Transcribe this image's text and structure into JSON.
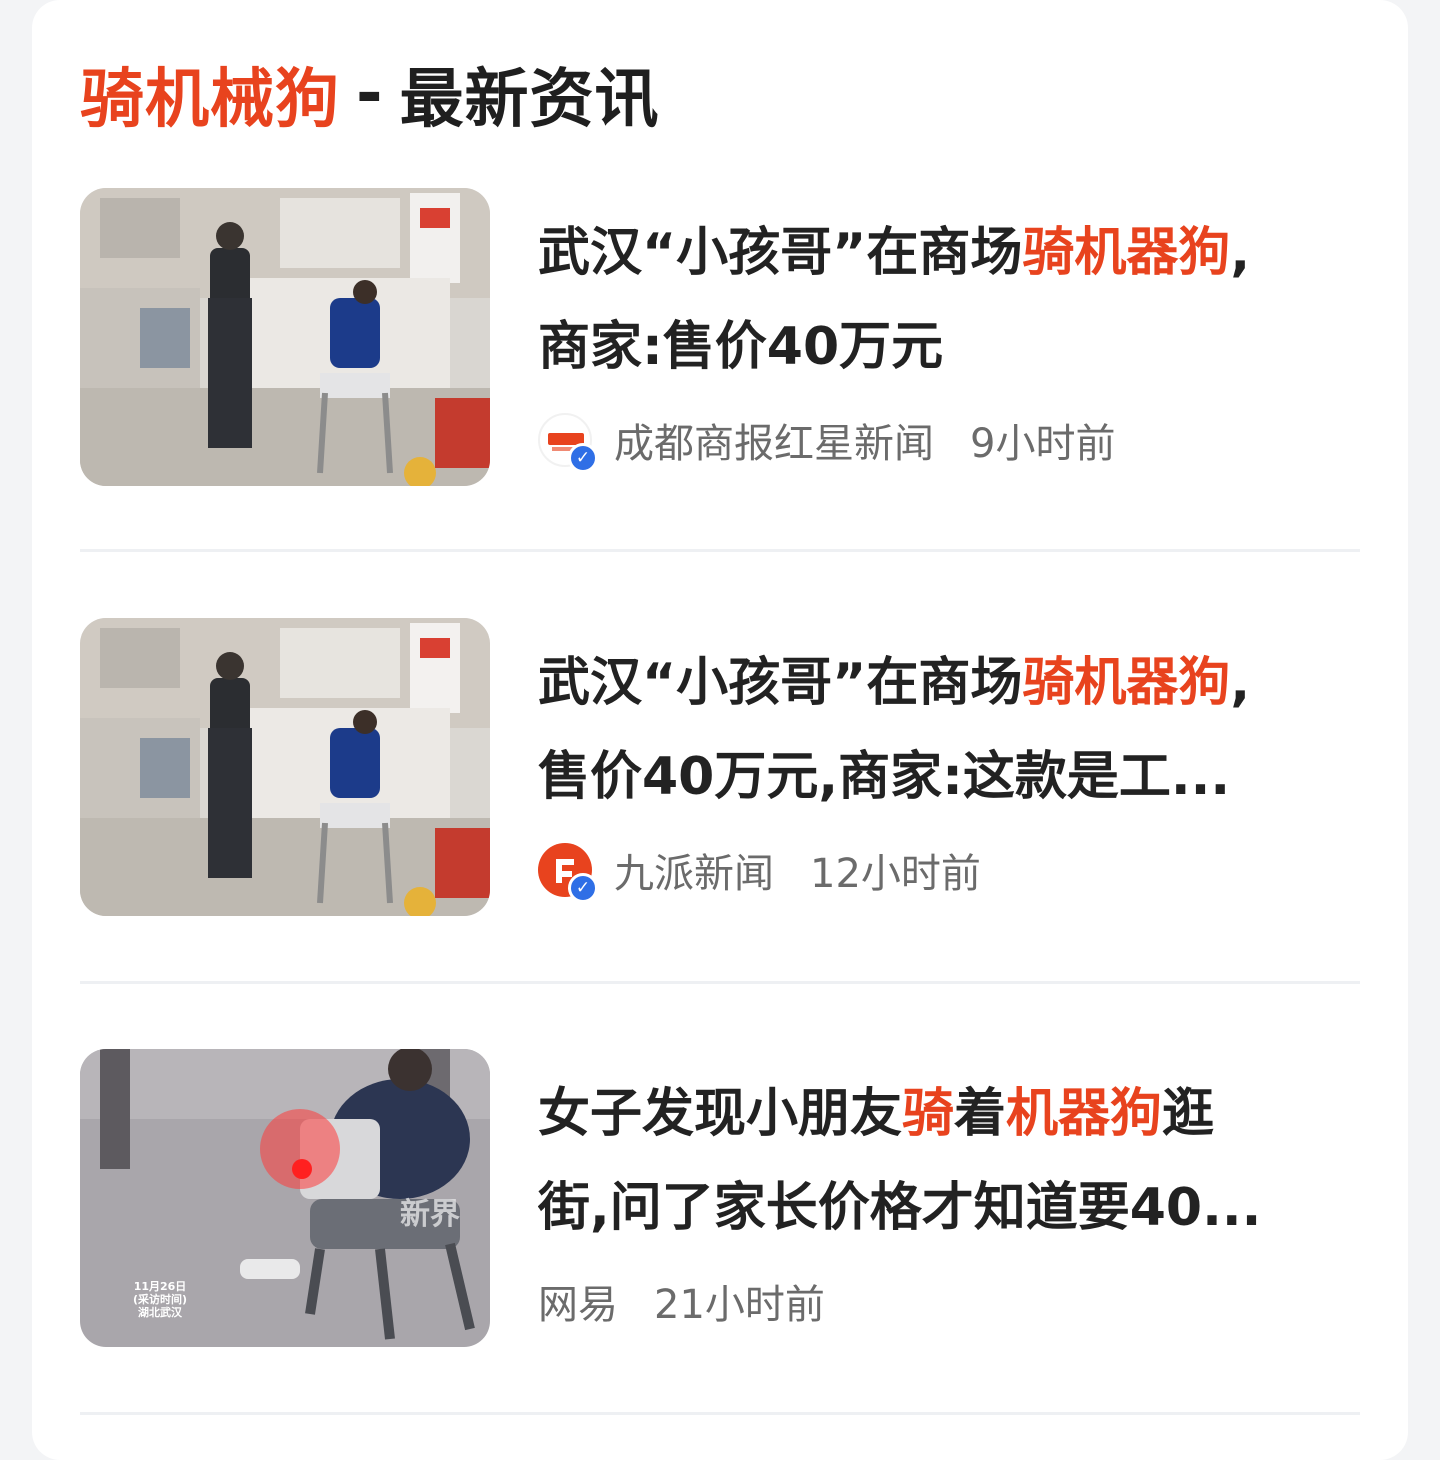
{
  "header": {
    "keyword": "骑机械狗",
    "separator": "-",
    "title": "最新资讯"
  },
  "articles": [
    {
      "title_line1": [
        {
          "text": "武汉“小孩哥”在商场",
          "highlight": false
        },
        {
          "text": "骑机器狗",
          "highlight": true
        },
        {
          "text": ",",
          "highlight": false
        }
      ],
      "title_line2": [
        {
          "text": "商家:售价40万元",
          "highlight": false
        }
      ],
      "source": "成都商报红星新闻",
      "time": "9小时前",
      "avatar_icon": "hongxing-news-logo-icon",
      "avatar_color": "#ffffff",
      "verified": true
    },
    {
      "title_line1": [
        {
          "text": "武汉“小孩哥”在商场",
          "highlight": false
        },
        {
          "text": "骑机器狗",
          "highlight": true
        },
        {
          "text": ",",
          "highlight": false
        }
      ],
      "title_line2": [
        {
          "text": "售价40万元,商家:这款是工...",
          "highlight": false
        }
      ],
      "source": "九派新闻",
      "time": "12小时前",
      "avatar_icon": "jiupai-news-logo-icon",
      "avatar_color": "#e8431e",
      "verified": true
    },
    {
      "title_line1": [
        {
          "text": "女子发现小朋友",
          "highlight": false
        },
        {
          "text": "骑",
          "highlight": true
        },
        {
          "text": "着",
          "highlight": false
        },
        {
          "text": "机器狗",
          "highlight": true
        },
        {
          "text": "逛",
          "highlight": false
        }
      ],
      "title_line2": [
        {
          "text": "街,问了家长价格才知道要40...",
          "highlight": false
        }
      ],
      "source": "网易",
      "time": "21小时前",
      "thumb_caption": [
        "11月26日",
        "(采访时间)",
        "湖北武汉"
      ],
      "thumb_watermark": "新界"
    }
  ],
  "colors": {
    "accent": "#e8431e",
    "verified": "#2f6fe6",
    "meta_text": "#6b6b6b"
  }
}
